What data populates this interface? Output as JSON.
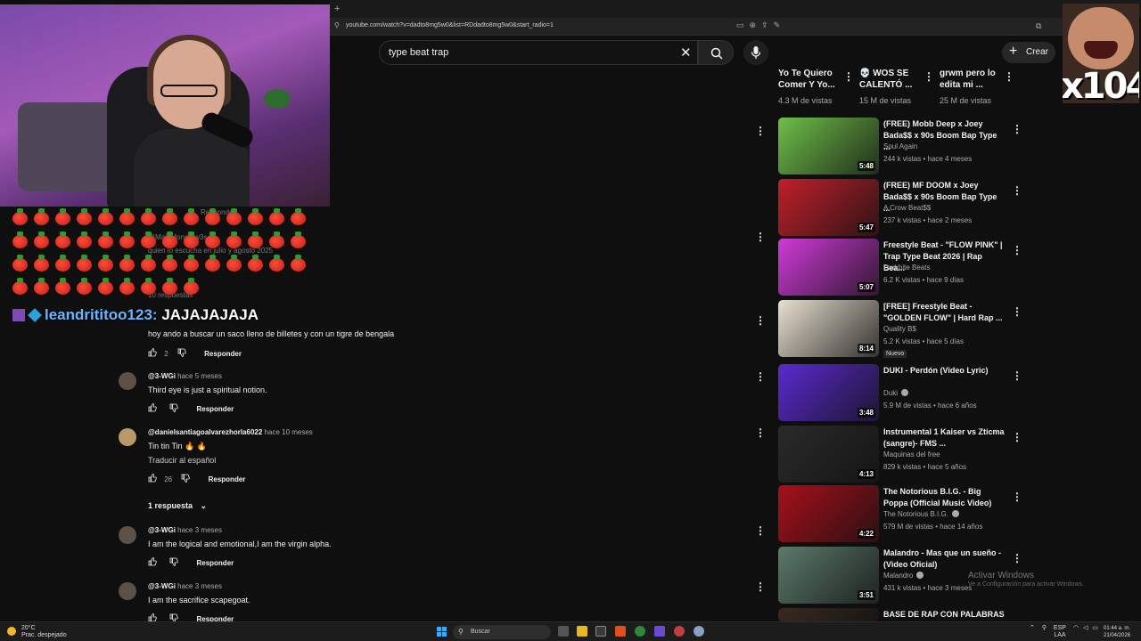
{
  "browser": {
    "url": "youtube.com/watch?v=dadto8mg5w0&list=RDdadto8mg5w0&start_radio=1",
    "new_tab": "+"
  },
  "header": {
    "search_value": "type beat trap",
    "create_label": "Crear"
  },
  "chat": {
    "user": "leandrititoo123:",
    "message": "JAJAJAJAJA",
    "emote_rows": [
      14,
      14,
      14,
      9
    ]
  },
  "ghost": {
    "respond_top": "Responder",
    "user_top": "@MaiaMonsruw3s",
    "text_top": "quien lo escucha en julio y agosto 2025",
    "replies_top": "10 respuestas"
  },
  "comments": [
    {
      "user": "",
      "time": "",
      "text": "hoy ando a buscar un saco lleno de billetes y con un tigre de bengala",
      "likes": "2",
      "reply": "Responder"
    },
    {
      "user": "@3-WGi",
      "time": "hace 5 meses",
      "text": "Third eye is just a spiritual notion.",
      "likes": "",
      "reply": "Responder"
    },
    {
      "user": "@danielsantiagoalvarezhorla6022",
      "time": "hace 10 meses",
      "text": "Tin tin Tin 🔥 🔥",
      "translate": "Traducir al español",
      "likes": "26",
      "reply": "Responder"
    },
    {
      "user": "@3-WGi",
      "time": "hace 3 meses",
      "text": "I am the logical and emotional,I am the virgin alpha.",
      "likes": "",
      "reply": "Responder"
    },
    {
      "user": "@3-WGi",
      "time": "hace 3 meses",
      "text": "I am the sacrifice scapegoat.",
      "likes": "",
      "reply": "Responder"
    }
  ],
  "replies_toggle": "1 respuesta",
  "sidebar": {
    "top_row": [
      {
        "title": "Yo Te Quiero Comer Y Yo...",
        "views": "4.3 M de vistas"
      },
      {
        "title": "💀 WOS SE CALENTÓ ...",
        "views": "15 M de vistas"
      },
      {
        "title": "grwm pero lo edita mi ...",
        "views": "25 M de vistas"
      }
    ],
    "videos": [
      {
        "title": "(FREE) Mobb Deep x Joey Bada$$ x 90s Boom Bap Type ...",
        "channel": "Soul Again",
        "verified": false,
        "meta": "244 k vistas • hace 4 meses",
        "duration": "5:48",
        "color": "#6fbf4a"
      },
      {
        "title": "(FREE) MF DOOM x Joey Bada$$ x 90s Boom Bap Type ...",
        "channel": "A Crow Beat$$",
        "verified": false,
        "meta": "237 k vistas • hace 2 meses",
        "duration": "5:47",
        "color": "#c0202a"
      },
      {
        "title": "Freestyle Beat - \"FLOW PINK\" | Trap Type Beat 2026 | Rap Bea...",
        "channel": "Darkbite Beats",
        "verified": false,
        "meta": "6.2 K vistas • hace 9 días",
        "duration": "5:07",
        "color": "#d03ad8"
      },
      {
        "title": "[FREE] Freestyle Beat - \"GOLDEN FLOW\" | Hard Rap ...",
        "channel": "Quality B$",
        "verified": false,
        "meta": "5.2 K vistas • hace 5 días",
        "duration": "8:14",
        "color": "#e8e0d0",
        "badge": "Nuevo"
      },
      {
        "title": "DUKI - Perdón (Video Lyric)",
        "channel": "Duki",
        "verified": true,
        "meta": "5.9 M de vistas • hace 6 años",
        "duration": "3:48",
        "color": "#5a2ad0"
      },
      {
        "title": "Instrumental 1  Kaiser vs Zticma (sangre)- FMS ...",
        "channel": "Maquinas del free",
        "verified": false,
        "meta": "829 k vistas • hace 5 años",
        "duration": "4:13",
        "color": "#2a2a2a"
      },
      {
        "title": "The Notorious B.I.G. - Big Poppa (Official Music Video)",
        "channel": "The Notorious B.I.G.",
        "verified": true,
        "meta": "579 M de vistas • hace 14 años",
        "duration": "4:22",
        "color": "#a8101a"
      },
      {
        "title": "Malandro - Mas que un sueño - (Video Oficial)",
        "channel": "Malandro",
        "verified": true,
        "meta": "431 k vistas • hace 3 meses",
        "duration": "3:51",
        "color": "#5b7a6a"
      },
      {
        "title": "BASE DE RAP CON PALABRAS",
        "channel": "",
        "verified": false,
        "meta": "",
        "duration": "",
        "color": "#3a2a20"
      }
    ]
  },
  "watermark": {
    "line1": "Activar Windows",
    "line2": "Ve a Configuración para activar Windows."
  },
  "taskbar": {
    "temp": "20°C",
    "weather": "Prac. despejado",
    "search": "Buscar",
    "lang1": "ESP",
    "lang2": "LAA",
    "time": "01:44 a. m.",
    "date": "21/04/2026"
  },
  "meme": {
    "text": "x104"
  }
}
